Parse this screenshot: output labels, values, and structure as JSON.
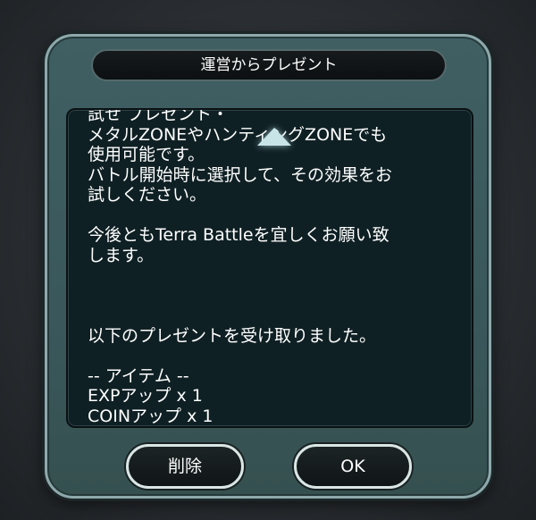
{
  "dialog": {
    "title": "運営からプレゼント",
    "message": "試せ ブレゼント・\nメタルZONEやハンティングZONEでも\n使用可能です。\nバトル開始時に選択して、その効果をお\n試しください。\n\n今後ともTerra Battleを宜しくお願い致\nします。\n\n\n\n以下のプレゼントを受け取りました。\n\n-- アイテム --\nEXPアップ x 1\nCOINアップ x 1",
    "delete_label": "削除",
    "ok_label": "OK"
  },
  "icons": {
    "scroll_up": "triangle-up-icon"
  }
}
